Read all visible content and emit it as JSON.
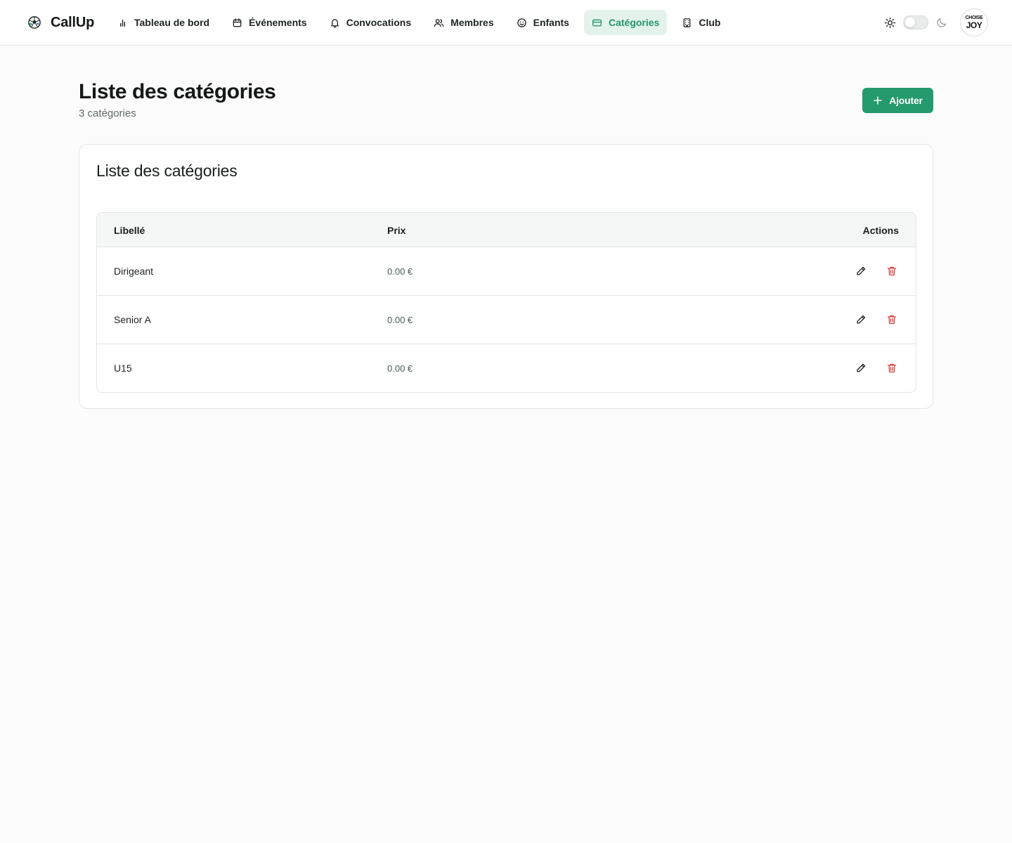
{
  "app": {
    "name": "CallUp",
    "logo_icon": "soccer-ball-icon"
  },
  "nav": {
    "items": [
      {
        "label": "Tableau de bord",
        "icon": "bar-chart-icon",
        "active": false
      },
      {
        "label": "Événements",
        "icon": "calendar-icon",
        "active": false
      },
      {
        "label": "Convocations",
        "icon": "bell-icon",
        "active": false
      },
      {
        "label": "Membres",
        "icon": "users-icon",
        "active": false
      },
      {
        "label": "Enfants",
        "icon": "smile-icon",
        "active": false
      },
      {
        "label": "Catégories",
        "icon": "card-icon",
        "active": true
      },
      {
        "label": "Club",
        "icon": "building-icon",
        "active": false
      }
    ]
  },
  "theme": {
    "light_icon": "sun-icon",
    "dark_icon": "moon-icon",
    "dark_mode_on": false
  },
  "avatar": {
    "line1": "CHOISE",
    "line2": "JOY"
  },
  "header": {
    "title": "Liste des catégories",
    "subtitle": "3 catégories",
    "add_label": "Ajouter"
  },
  "card": {
    "title": "Liste des catégories"
  },
  "table": {
    "columns": {
      "label": "Libellé",
      "price": "Prix",
      "actions": "Actions"
    },
    "rows": [
      {
        "label": "Dirigeant",
        "price": "0.00 €"
      },
      {
        "label": "Senior A",
        "price": "0.00 €"
      },
      {
        "label": "U15",
        "price": "0.00 €"
      }
    ]
  },
  "colors": {
    "accent": "#259a6c",
    "active_nav_bg": "#e3f3ec",
    "delete": "#d93a3a"
  }
}
